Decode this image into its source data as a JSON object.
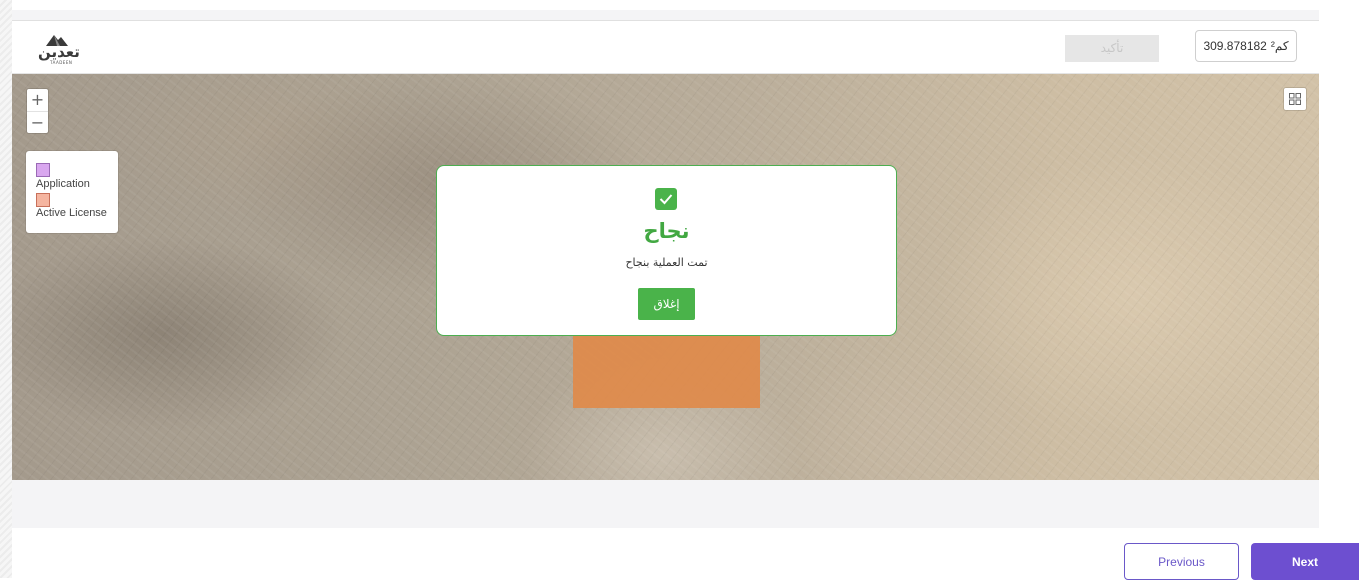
{
  "header": {
    "logo_text": "تعدين",
    "logo_subtext": "TAADEEN",
    "confirm_label": "تأكيد",
    "area": {
      "value": "309.878182",
      "unit": "كم²"
    }
  },
  "map": {
    "zoom_in": "+",
    "zoom_out": "−",
    "legend": [
      {
        "label": "Application",
        "color": "#d9a7ef"
      },
      {
        "label": "Active License",
        "color": "#f5b5a0"
      }
    ],
    "license_polygon_color": "#e08a4a"
  },
  "modal": {
    "title": "نجاح",
    "message": "تمت العملية بنجاح",
    "close_label": "إغلاق",
    "accent_color": "#4ab34a"
  },
  "footer": {
    "previous_label": "Previous",
    "next_label": "Next",
    "brand_color": "#6d4fd0"
  }
}
